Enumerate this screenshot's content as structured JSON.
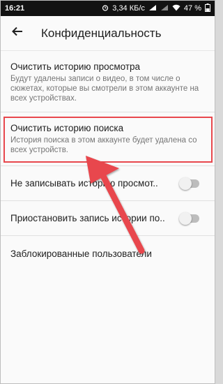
{
  "status_bar": {
    "time": "16:21",
    "speed": "3,34 КБ/с",
    "battery": "47 %"
  },
  "app_bar": {
    "title": "Конфиденциальность"
  },
  "settings": [
    {
      "title": "Очистить историю просмотра",
      "subtitle": "Будут удалены записи о видео, в том числе о сюжетах, которые вы смотрели в этом аккаунте на всех устройствах."
    },
    {
      "title": "Очистить историю поиска",
      "subtitle": "История поиска в этом аккаунте будет удалена со всех устройств."
    },
    {
      "title": "Не записывать историю просмот..",
      "enabled": false
    },
    {
      "title": "Приостановить запись истории по..",
      "enabled": false
    },
    {
      "title": "Заблокированные пользователи"
    }
  ],
  "annotation": {
    "highlight_color": "#e8474d"
  }
}
